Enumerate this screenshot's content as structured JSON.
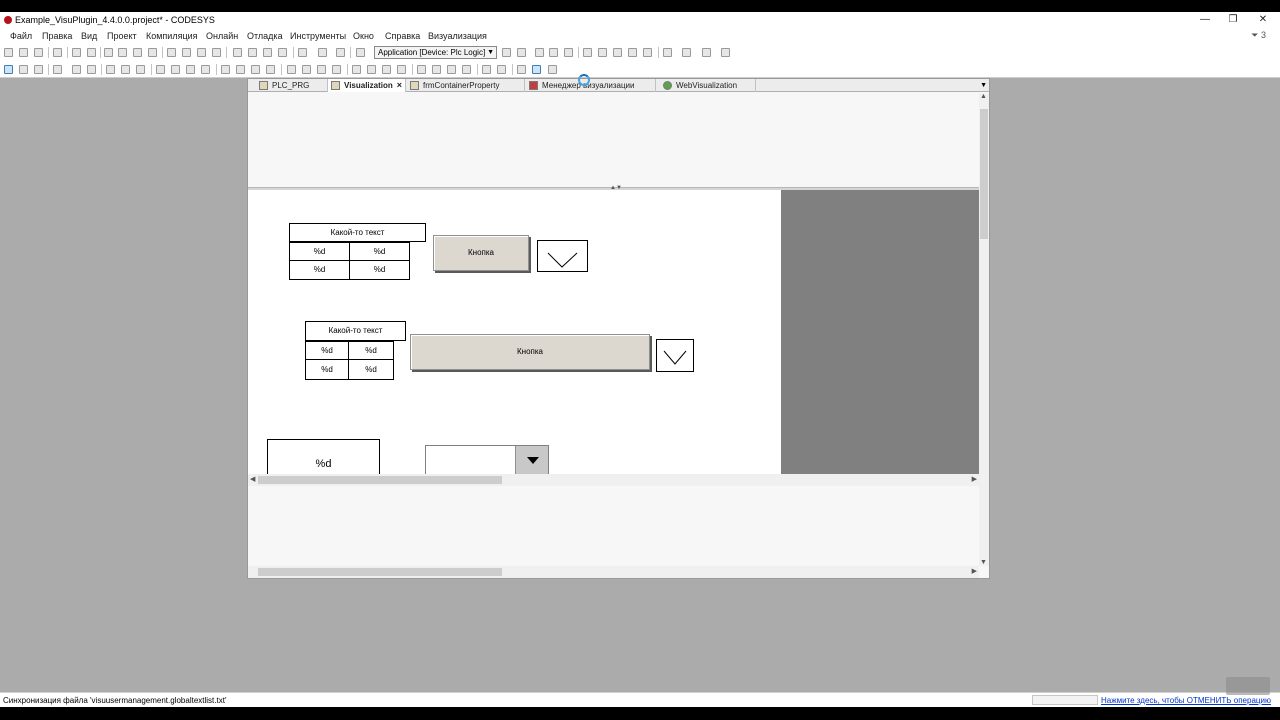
{
  "window": {
    "title": "Example_VisuPlugin_4.4.0.0.project* - CODESYS",
    "minimize": "—",
    "restore": "❐",
    "close": "✕"
  },
  "menu": {
    "items": [
      "Файл",
      "Правка",
      "Вид",
      "Проект",
      "Компиляция",
      "Онлайн",
      "Отладка",
      "Инструменты",
      "Окно",
      "Справка",
      "Визуализация"
    ],
    "filter_count": "3"
  },
  "toolbar": {
    "application_select": "Application [Device: Plc Logic]"
  },
  "tabs": [
    {
      "label": "PLC_PRG",
      "active": false
    },
    {
      "label": "Visualization",
      "active": true
    },
    {
      "label": "frmContainerProperty",
      "active": false
    },
    {
      "label": "Менеджер визуализации",
      "active": false
    },
    {
      "label": "WebVisualization",
      "active": false
    }
  ],
  "visu": {
    "group1": {
      "title": "Какой-то текст",
      "cells": [
        "%d",
        "%d",
        "%d",
        "%d"
      ],
      "button": "Кнопка"
    },
    "group2": {
      "title": "Какой-то текст",
      "cells": [
        "%d",
        "%d",
        "%d",
        "%d"
      ],
      "button": "Кнопка"
    },
    "group3": {
      "textfield": "%d"
    }
  },
  "status": {
    "text": "Синхронизация файла 'visuusermanagement.globaltextlist.txt'",
    "cancel_link": "Нажмите здесь, чтобы ОТМЕНИТЬ операцию"
  },
  "colors": {
    "canvas_bg": "#ffffff",
    "gray_area": "#808080",
    "button_face": "#dcd8d0",
    "link": "#0033cc"
  }
}
